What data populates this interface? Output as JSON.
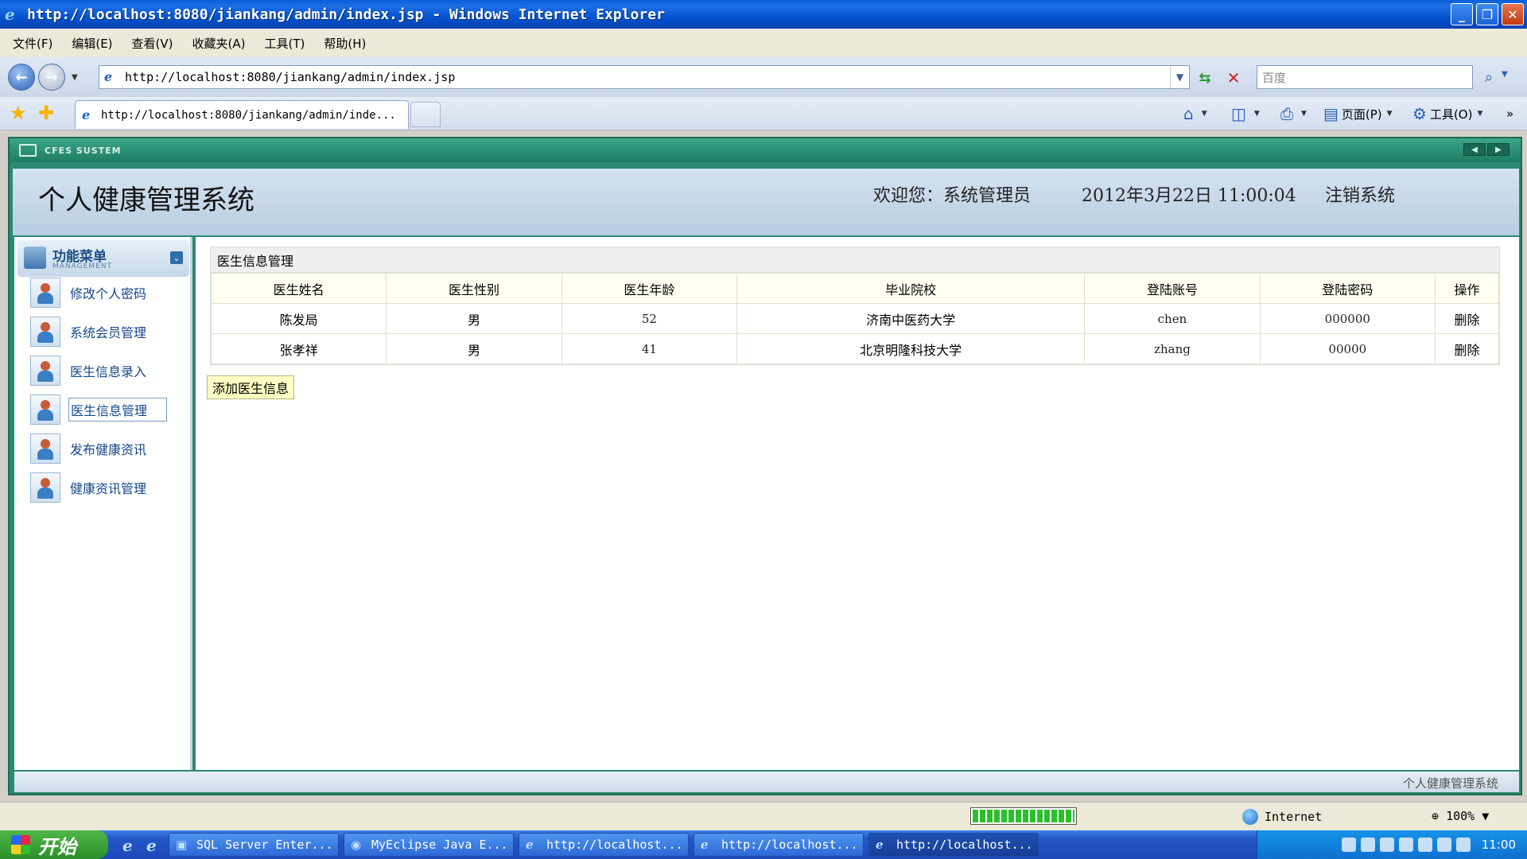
{
  "window": {
    "title": "http://localhost:8080/jiankang/admin/index.jsp - Windows Internet Explorer"
  },
  "menubar": [
    "文件(F)",
    "编辑(E)",
    "查看(V)",
    "收藏夹(A)",
    "工具(T)",
    "帮助(H)"
  ],
  "address": {
    "url": "http://localhost:8080/jiankang/admin/index.jsp",
    "search_placeholder": "百度"
  },
  "tab": {
    "label": "http://localhost:8080/jiankang/admin/inde..."
  },
  "commandbar": {
    "page_label": "页面(P)",
    "tools_label": "工具(O)"
  },
  "app": {
    "strip_text": "CFES SUSTEM",
    "title": "个人健康管理系统",
    "welcome": "欢迎您：系统管理员",
    "datetime": "2012年3月22日  11:00:04",
    "logout": "注销系统",
    "footer": "个人健康管理系统"
  },
  "sidebar": {
    "title": "功能菜单",
    "subtitle": "MANAGEMENT",
    "items": [
      {
        "label": "修改个人密码"
      },
      {
        "label": "系统会员管理"
      },
      {
        "label": "医生信息录入"
      },
      {
        "label": "医生信息管理"
      },
      {
        "label": "发布健康资讯"
      },
      {
        "label": "健康资讯管理"
      }
    ]
  },
  "panel": {
    "title": "医生信息管理",
    "columns": [
      "医生姓名",
      "医生性别",
      "医生年龄",
      "毕业院校",
      "登陆账号",
      "登陆密码",
      "操作"
    ],
    "rows": [
      {
        "name": "陈发局",
        "gender": "男",
        "age": "52",
        "school": "济南中医药大学",
        "account": "chen",
        "password": "000000",
        "action": "删除"
      },
      {
        "name": "张孝祥",
        "gender": "男",
        "age": "41",
        "school": "北京明隆科技大学",
        "account": "zhang",
        "password": "00000",
        "action": "删除"
      }
    ],
    "add_button": "添加医生信息"
  },
  "statusbar": {
    "progress": 1.0,
    "zone": "Internet",
    "zoom": "100%"
  },
  "taskbar": {
    "start": "开始",
    "tasks": [
      {
        "label": "SQL Server Enter..."
      },
      {
        "label": "MyEclipse Java E..."
      },
      {
        "label": "http://localhost..."
      },
      {
        "label": "http://localhost..."
      },
      {
        "label": "http://localhost..."
      }
    ],
    "clock": "11:00"
  }
}
